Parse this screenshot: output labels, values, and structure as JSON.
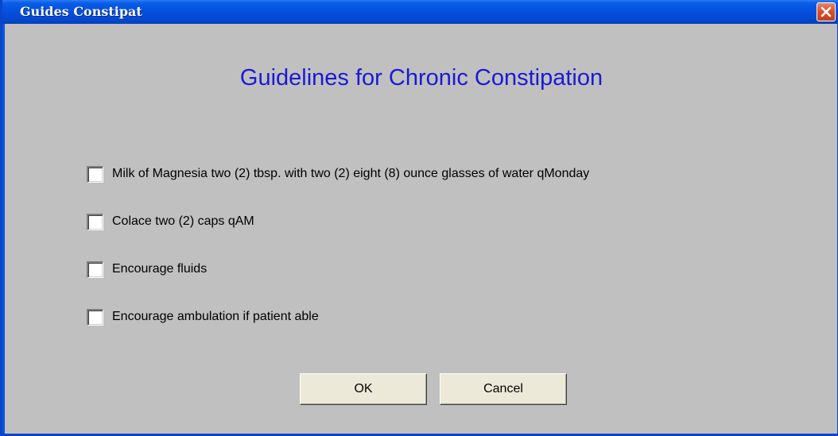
{
  "window": {
    "title": "Guides Constipat"
  },
  "dialog": {
    "heading": "Guidelines for Chronic Constipation",
    "options": [
      {
        "label": "Milk of Magnesia two (2) tbsp. with two (2) eight (8) ounce glasses of water qMonday",
        "checked": false
      },
      {
        "label": "Colace two (2) caps qAM",
        "checked": false
      },
      {
        "label": "Encourage fluids",
        "checked": false
      },
      {
        "label": "Encourage ambulation if patient able",
        "checked": false
      }
    ],
    "buttons": {
      "ok": "OK",
      "cancel": "Cancel"
    }
  },
  "colors": {
    "titlebar": "#0553e0",
    "heading": "#1a1ad6",
    "client_bg": "#c0c0c0",
    "close_button": "#d8522e"
  }
}
